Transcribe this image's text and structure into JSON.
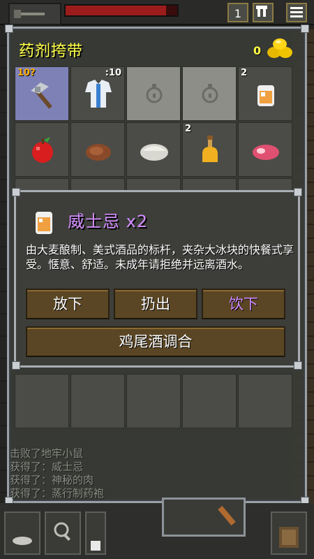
{
  "hud": {
    "depth_label": "1",
    "health_fraction": 0.9,
    "buttons": [
      "1",
      "keys",
      "menu"
    ]
  },
  "bag": {
    "title": "药剂挎带",
    "gold": "0",
    "gold_icon": "gold-pile-icon",
    "slots": [
      {
        "icon": "pickaxe-icon",
        "qty": "10?",
        "qty_color": "#ffb000",
        "selected": true
      },
      {
        "icon": "cloth-armor-icon",
        "qty": ":10"
      },
      {
        "icon": "empty-slot-icon",
        "qty": ""
      },
      {
        "icon": "empty-slot-icon",
        "qty": ""
      },
      {
        "icon": "whiskey-icon",
        "qty": "2"
      },
      {
        "icon": "apple-icon",
        "qty": ""
      },
      {
        "icon": "meat-icon",
        "qty": ""
      },
      {
        "icon": "pasty-icon",
        "qty": ""
      },
      {
        "icon": "potion-bottle-icon",
        "qty": "2"
      },
      {
        "icon": "raw-steak-icon",
        "qty": ""
      }
    ]
  },
  "popup": {
    "icon": "whiskey-icon",
    "title": "威士忌 x2",
    "description": "由大麦酿制、美式酒品的标杆，夹杂大冰块的快餐式享受。惬意、舒适。未成年请拒绝并远离酒水。",
    "buttons": {
      "drop": "放下",
      "throw": "扔出",
      "drink": "饮下",
      "cocktail": "鸡尾酒调合"
    },
    "title_color": "#d28cff"
  },
  "log": [
    "击败了地牢小鼠",
    "获得了：威士忌",
    "获得了：神秘的肉",
    "获得了：蒸行制药袍"
  ],
  "colors": {
    "title_yellow": "#ffff44",
    "button_brown": "#5a4624",
    "highlight_purple": "#d28cff"
  }
}
